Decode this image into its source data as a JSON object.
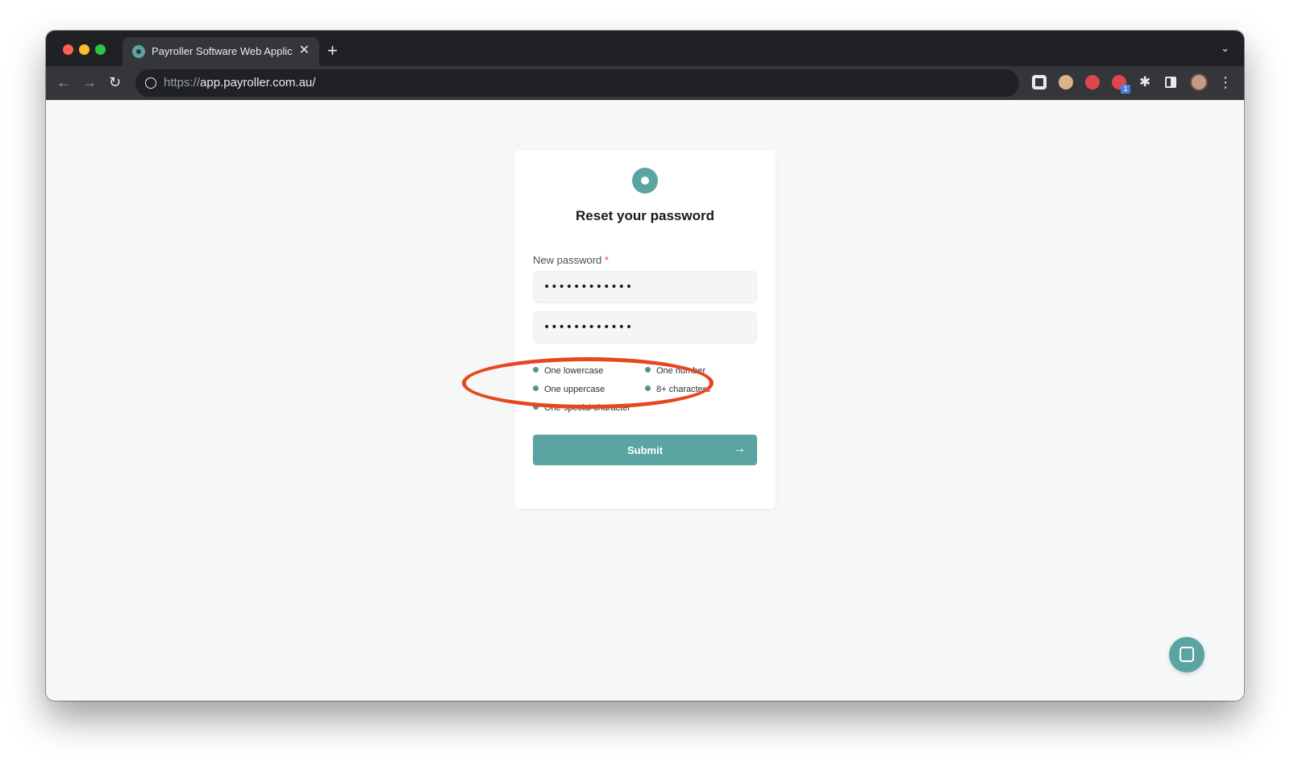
{
  "browser": {
    "tab": {
      "title": "Payroller Software Web Applic",
      "favicon": "payroller-logo-icon",
      "close": "✕"
    },
    "new_tab": "+",
    "url_scheme": "https://",
    "url_host": "app.payroller.com.au/",
    "extensions": [
      {
        "name": "qr-code-extension-icon"
      },
      {
        "name": "owl-extension-icon"
      },
      {
        "name": "red-extension-icon"
      },
      {
        "name": "badge-extension-icon",
        "badge": "1"
      },
      {
        "name": "puzzle-extensions-icon"
      },
      {
        "name": "side-panel-icon"
      },
      {
        "name": "profile-avatar"
      },
      {
        "name": "menu-kebab-icon"
      }
    ],
    "extension_badge_count": "1"
  },
  "reset_form": {
    "title": "Reset your password",
    "new_password_label": "New password",
    "required_marker": "*",
    "new_password_value": "••••••••••••",
    "confirm_password_value": "••••••••••••",
    "requirements": {
      "lowercase": "One lowercase",
      "number": "One number",
      "uppercase": "One uppercase",
      "characters": "8+ characters",
      "special": "One special character"
    },
    "submit_label": "Submit",
    "submit_arrow": "→"
  },
  "colors": {
    "brand_teal": "#5aa4a2",
    "highlight_red": "#e8461f",
    "requirement_dot": "#5a8f8d"
  }
}
